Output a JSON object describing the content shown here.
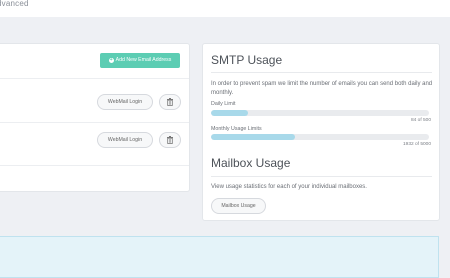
{
  "header": {
    "crumb": "dvanced"
  },
  "email_panel": {
    "add_label": "Add New Email Address",
    "rows": [
      {
        "webmail_label": "WebMail Login"
      },
      {
        "webmail_label": "WebMail Login"
      }
    ]
  },
  "smtp": {
    "title": "SMTP Usage",
    "description": "In order to prevent spam we limit the number of emails you can send both daily and monthly.",
    "daily": {
      "label": "Daily Limit",
      "count": "84 of 500",
      "fraction": 0.168
    },
    "monthly": {
      "label": "Monthly Usage Limits",
      "count": "1932 of 5000",
      "fraction": 0.386
    }
  },
  "mailbox": {
    "title": "Mailbox Usage",
    "description": "View usage statistics for each of your individual mailboxes.",
    "button_label": "Mailbox Usage"
  },
  "colors": {
    "accent": "#5ccdb3",
    "bar_fill": "#a8d9ea",
    "info_band": "#e4f3f9"
  }
}
